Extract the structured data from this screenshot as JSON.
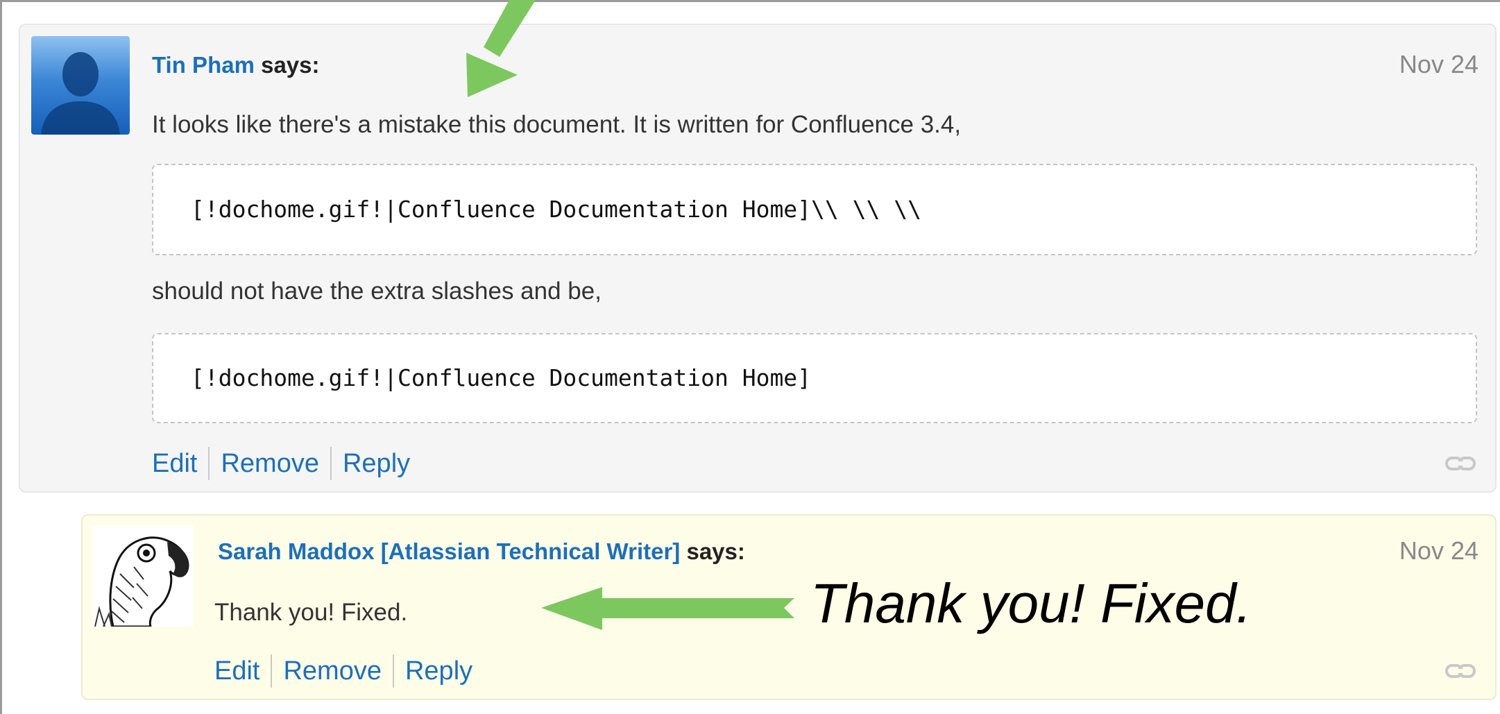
{
  "comments": [
    {
      "author": "Tin Pham",
      "says": "says:",
      "date": "Nov 24",
      "paragraph_1": "It looks like there's a mistake this document. It is written for Confluence 3.4,",
      "code_1": "[!dochome.gif!|Confluence Documentation Home]\\\\ \\\\ \\\\",
      "paragraph_2": "should not have the extra slashes and be,",
      "code_2": "[!dochome.gif!|Confluence Documentation Home]",
      "actions": [
        "Edit",
        "Remove",
        "Reply"
      ]
    },
    {
      "author": "Sarah Maddox [Atlassian Technical Writer]",
      "says": "says:",
      "date": "Nov 24",
      "paragraph_1": "Thank you! Fixed.",
      "actions": [
        "Edit",
        "Remove",
        "Reply"
      ]
    }
  ],
  "annotation": {
    "text": "Thank you! Fixed.",
    "arrow_color": "#7dc75f"
  },
  "icons": {
    "avatar_1": "default-user-silhouette-icon",
    "avatar_2": "parrot-sketch-avatar",
    "permalink": "permalink-chain-icon"
  },
  "colors": {
    "link": "#1d6fb8",
    "comment_bg": "#f5f5f5",
    "reply_bg": "#fefde8"
  }
}
